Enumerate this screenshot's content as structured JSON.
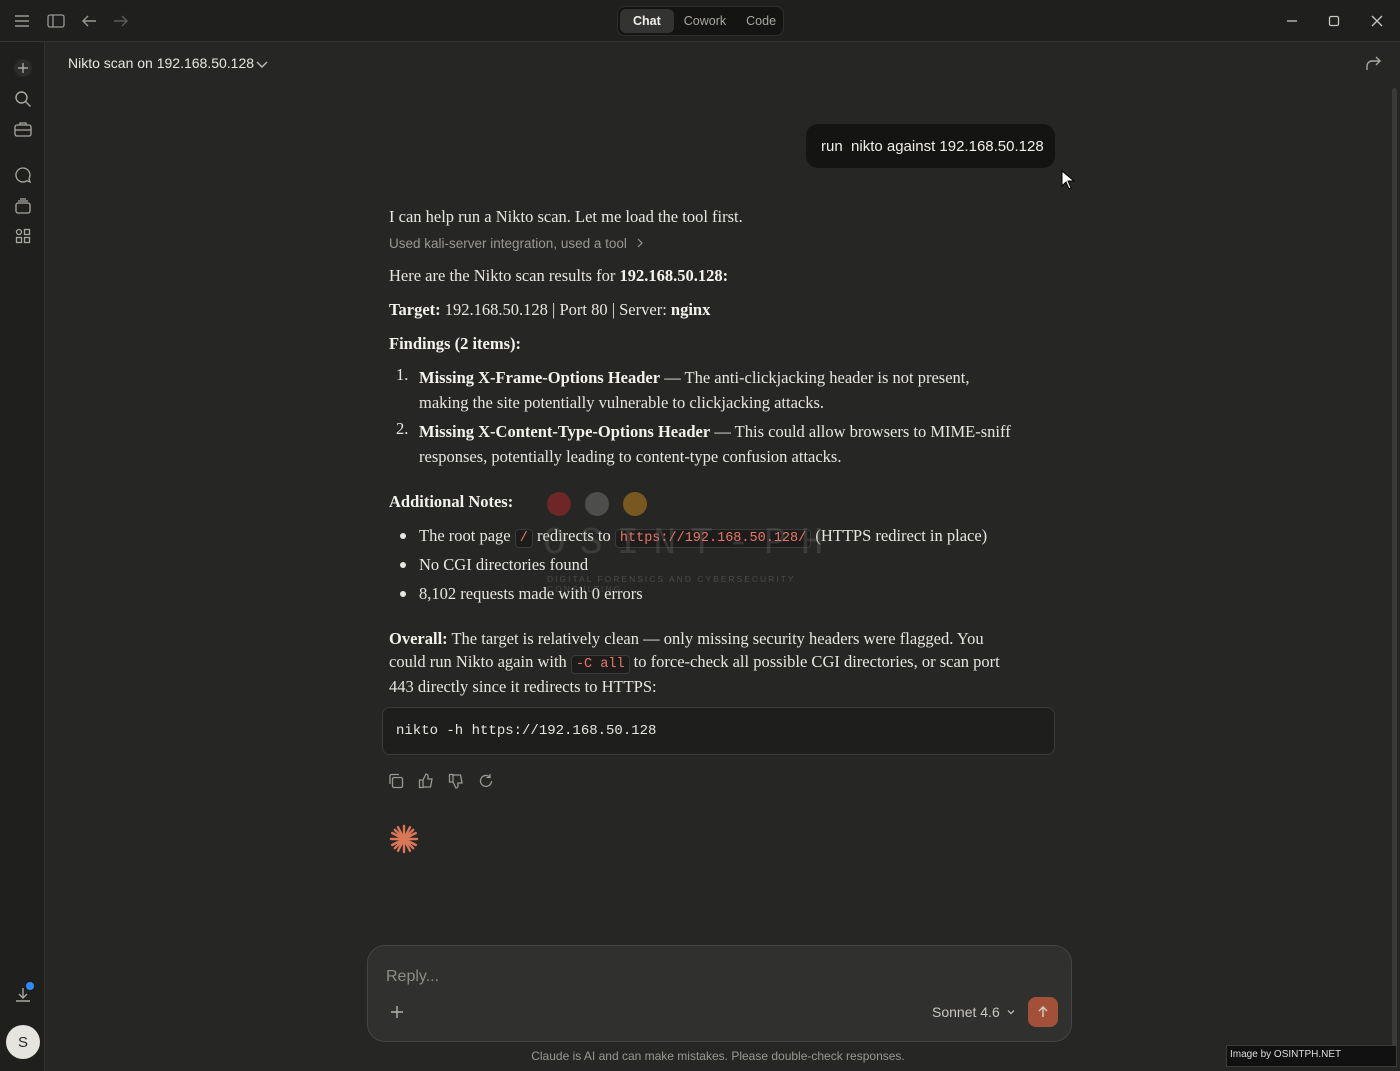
{
  "titlebar": {
    "tabs": [
      {
        "label": "Chat",
        "active": true
      },
      {
        "label": "Cowork",
        "active": false
      },
      {
        "label": "Code",
        "active": false
      }
    ]
  },
  "header": {
    "title": "Nikto scan on 192.168.50.128"
  },
  "user_message": "run  nikto against 192.168.50.128",
  "response": {
    "intro": "I can help run a Nikto scan. Let me load the tool first.",
    "tool_usage": "Used kali-server integration, used a tool",
    "results_prefix": "Here are the Nikto scan results for ",
    "results_ip": "192.168.50.128:",
    "target_label": "Target:",
    "target_value": " 192.168.50.128 | Port 80 | Server: ",
    "server": "nginx",
    "findings_heading": "Findings (2 items):",
    "findings": [
      {
        "num": "1.",
        "title": "Missing X-Frame-Options Header",
        "line1": " — The anti-clickjacking header is not present,",
        "line2": "making the site potentially vulnerable to clickjacking attacks."
      },
      {
        "num": "2.",
        "title": "Missing X-Content-Type-Options Header",
        "line1": " — This could allow browsers to MIME-sniff",
        "line2": "responses, potentially leading to content-type confusion attacks."
      }
    ],
    "notes_heading": "Additional Notes:",
    "note1_a": "The root page ",
    "note1_code1": "/",
    "note1_b": " redirects to ",
    "note1_code2": "https://192.168.50.128/",
    "note1_c": " (HTTPS redirect in place)",
    "note2": "No CGI directories found",
    "note3": "8,102 requests made with 0 errors",
    "overall_label": "Overall:",
    "overall_line1": " The target is relatively clean — only missing security headers were flagged. You",
    "overall_line2_a": "could run Nikto again with ",
    "overall_code": "-C all",
    "overall_line2_b": " to force-check all possible CGI directories, or scan port",
    "overall_line3": "443 directly since it redirects to HTTPS:",
    "command": "nikto -h https://192.168.50.128"
  },
  "watermark": {
    "text": "OSINT-PH",
    "subtitle": "DIGITAL FORENSICS AND CYBERSECURITY CONSULTING"
  },
  "composer": {
    "placeholder": "Reply...",
    "model": "Sonnet 4.6",
    "disclaimer": "Claude is AI and can make mistakes. Please double-check responses."
  },
  "user": {
    "avatar_initial": "S"
  },
  "credit": "Image by OSINTPH.NET",
  "colors": {
    "accent": "#d97757",
    "inline_code": "#e8766a"
  }
}
